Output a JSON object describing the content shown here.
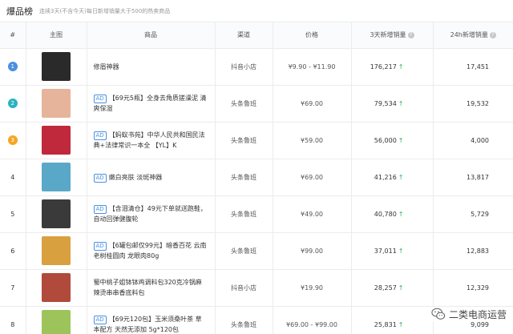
{
  "header": {
    "title": "爆品榜",
    "subtitle": "连续3天(不含今天)每日新增销量大于500的热卖商品"
  },
  "columns": {
    "rank": "#",
    "image": "主图",
    "product": "商品",
    "channel": "渠道",
    "price": "价格",
    "sales3d": "3天新增销量",
    "sales24h": "24h新增销量"
  },
  "ad_label": "AD",
  "rows": [
    {
      "rank": "1",
      "title": "修眉神器",
      "ad": false,
      "channel": "抖音小店",
      "price": "¥9.90 - ¥11.90",
      "sales3d": "176,217",
      "sales24h": "17,451",
      "thumb_color": "#2a2a2a"
    },
    {
      "rank": "2",
      "title": "【69元5瓶】全身去角质搓澡泥 清爽保湿",
      "ad": true,
      "channel": "头条鲁班",
      "price": "¥69.00",
      "sales3d": "79,534",
      "sales24h": "19,532",
      "thumb_color": "#e6b49a"
    },
    {
      "rank": "3",
      "title": "【蚂蚁书苑】中华人民共和国民法典+法律常识一本全 【YL】K",
      "ad": true,
      "channel": "头条鲁班",
      "price": "¥59.00",
      "sales3d": "56,000",
      "sales24h": "4,000",
      "thumb_color": "#c0283c"
    },
    {
      "rank": "4",
      "title": "嫩白亮肤 淡斑神器",
      "ad": true,
      "channel": "头条鲁班",
      "price": "¥69.00",
      "sales3d": "41,216",
      "sales24h": "13,817",
      "thumb_color": "#5aa8c8"
    },
    {
      "rank": "5",
      "title": "【含泪清仓】49元下单就送跑鞋，自动回弹健腹轮",
      "ad": true,
      "channel": "头条鲁班",
      "price": "¥49.00",
      "sales3d": "40,780",
      "sales24h": "5,729",
      "thumb_color": "#3a3a3a"
    },
    {
      "rank": "6",
      "title": "【6罐包邮仅99元】暗香百花 云南老树桂圆肉 龙眼肉80g",
      "ad": true,
      "channel": "头条鲁班",
      "price": "¥99.00",
      "sales3d": "37,011",
      "sales24h": "12,883",
      "thumb_color": "#d9a040"
    },
    {
      "rank": "7",
      "title": "蜀中桃子姐钵钵鸡调料包320克冷锅麻辣烫串串香底料包",
      "ad": false,
      "channel": "抖音小店",
      "price": "¥19.90",
      "sales3d": "28,257",
      "sales24h": "12,329",
      "thumb_color": "#b04a3a"
    },
    {
      "rank": "8",
      "title": "【69元120包】玉米须桑叶茶 草本配方 天然无添加 5g*120包",
      "ad": true,
      "channel": "头条鲁班",
      "price": "¥69.00 - ¥99.00",
      "sales3d": "25,831",
      "sales24h": "9,099",
      "thumb_color": "#9cc45a"
    }
  ],
  "watermark": {
    "text": "二类电商运营",
    "icon": "wechat-icon"
  },
  "colors": {
    "accent": "#4a90e2",
    "rank2": "#2bb3c0",
    "rank3": "#f5a623",
    "up_arrow": "#2bb35a"
  }
}
